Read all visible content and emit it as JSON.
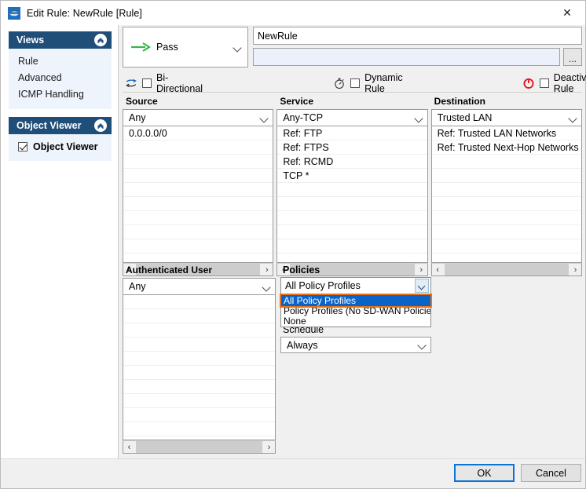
{
  "window": {
    "title": "Edit Rule: NewRule [Rule]",
    "icon": "rule-document-icon",
    "close_label": "✕"
  },
  "sidebar": {
    "panes": [
      {
        "title": "Views",
        "collapse_icon": "«",
        "items": [
          {
            "label": "Rule"
          },
          {
            "label": "Advanced"
          },
          {
            "label": "ICMP Handling"
          }
        ]
      },
      {
        "title": "Object Viewer",
        "collapse_icon": "«",
        "checkbox_items": [
          {
            "label": "Object Viewer",
            "checked": true
          }
        ]
      }
    ]
  },
  "form": {
    "action": {
      "value": "Pass",
      "icon": "green-right-arrow-icon"
    },
    "rule_name": "NewRule",
    "description": "",
    "browse_button": "...",
    "checkboxes": [
      {
        "name": "bi-directional",
        "label": "Bi-Directional",
        "checked": false,
        "icon": "bidirectional-arrows-icon"
      },
      {
        "name": "dynamic-rule",
        "label": "Dynamic Rule",
        "checked": false,
        "icon": "stopwatch-icon"
      },
      {
        "name": "deactivate-rule",
        "label": "Deactivate Rule",
        "checked": false,
        "icon": "power-off-icon"
      }
    ]
  },
  "columns": [
    {
      "title": "Source",
      "selected": "Any",
      "items": [
        "0.0.0.0/0"
      ]
    },
    {
      "title": "Service",
      "selected": "Any-TCP",
      "items": [
        "Ref: FTP",
        "Ref: FTPS",
        "Ref: RCMD",
        "TCP  *"
      ]
    },
    {
      "title": "Destination",
      "selected": "Trusted LAN",
      "items": [
        "Ref: Trusted LAN Networks",
        "Ref: Trusted Next-Hop Networks"
      ]
    }
  ],
  "authenticated_user": {
    "title": "Authenticated User",
    "selected": "Any",
    "items": []
  },
  "policies": {
    "title": "Policies",
    "selected": "All Policy Profiles",
    "open": true,
    "options": [
      {
        "label": "All Policy Profiles",
        "selected": true
      },
      {
        "label": "Policy Profiles (No SD-WAN Policies)",
        "selected": false
      },
      {
        "label": "None",
        "selected": false
      }
    ]
  },
  "schedule": {
    "title": "Schedule",
    "selected": "Always"
  },
  "footer": {
    "ok_label": "OK",
    "cancel_label": "Cancel"
  },
  "scrollbar": {
    "left_arrow": "‹",
    "right_arrow": "›"
  },
  "colors": {
    "pane_header": "#1f4e79",
    "pane_body": "#eef4fb",
    "accent_selection": "#0a64c8",
    "accent_highlight": "#e8711a",
    "pass_arrow": "#3ab54a",
    "deactivate_icon": "#e01b24",
    "focus_border": "#0a74d6"
  }
}
